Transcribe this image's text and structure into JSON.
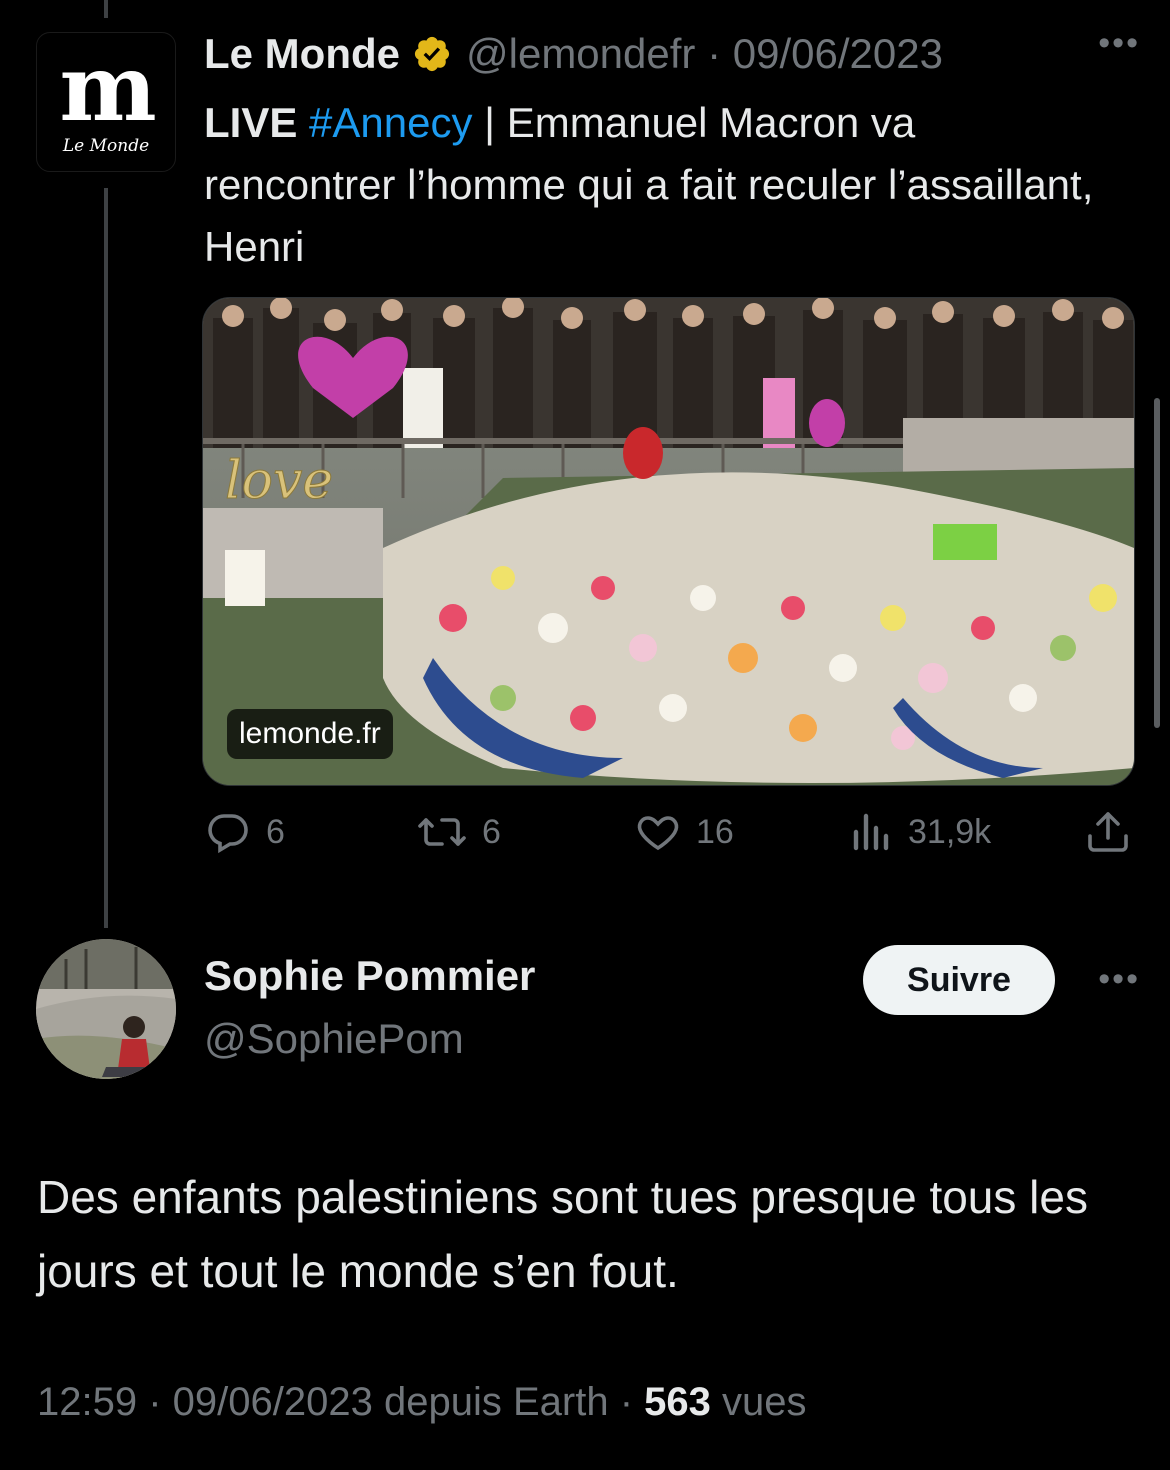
{
  "quoted_tweet": {
    "author_name": "Le Monde",
    "handle": "@lemondefr",
    "date": "09/06/2023",
    "avatar_letter": "m",
    "avatar_caption": "Le Monde",
    "text_live": "LIVE",
    "text_hashtag": "#Annecy",
    "text_separator": " | ",
    "text_body": "Emmanuel Macron va rencontrer l’homme qui a fait reculer l’assaillant, Henri",
    "media_domain": "lemonde.fr",
    "media_balloon_text": "love",
    "stats": {
      "replies": "6",
      "retweets": "6",
      "likes": "16",
      "views": "31,9k"
    }
  },
  "tweet": {
    "author_name": "Sophie Pommier",
    "handle": "@SophiePom",
    "follow_label": "Suivre",
    "text": "Des enfants palestiniens sont tues presque tous les jours et tout le monde s’en fout.",
    "time": "12:59",
    "date": "09/06/2023",
    "source": "depuis Earth",
    "views_count": "563",
    "views_label": "vues"
  },
  "colors": {
    "background": "#000000",
    "text": "#e7e9ea",
    "muted": "#71767b",
    "link": "#1d9bf0",
    "verified_gold": "#e2b719"
  },
  "icons": [
    "reply-icon",
    "retweet-icon",
    "like-icon",
    "views-icon",
    "share-icon",
    "verified-badge-icon",
    "more-icon"
  ]
}
